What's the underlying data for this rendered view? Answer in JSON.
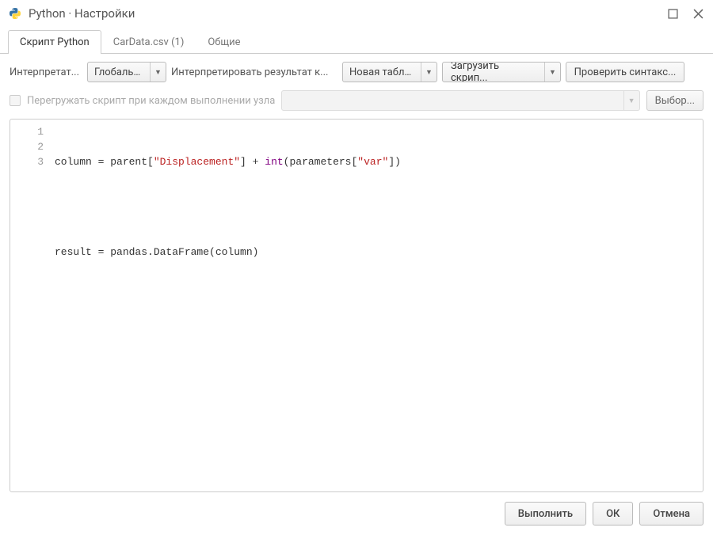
{
  "window": {
    "title": "Python · Настройки"
  },
  "tabs": [
    {
      "label": "Скрипт Python",
      "active": true
    },
    {
      "label": "CarData.csv (1)",
      "active": false
    },
    {
      "label": "Общие",
      "active": false
    }
  ],
  "toolbar": {
    "interpreter_label": "Интерпретат...",
    "interpreter_value": "Глобальн...",
    "interpret_as_label": "Интерпретировать результат к...",
    "interpret_as_value": "Новая табли...",
    "load_script": "Загрузить скрип...",
    "check_syntax": "Проверить синтакс..."
  },
  "reload": {
    "label": "Перегружать скрипт при каждом выполнении узла",
    "select": "Выбор..."
  },
  "code": {
    "lines": [
      "1",
      "2",
      "3"
    ],
    "l1_a": "column = parent[",
    "l1_b": "\"Displacement\"",
    "l1_c": "] + ",
    "l1_d": "int",
    "l1_e": "(parameters[",
    "l1_f": "\"var\"",
    "l1_g": "])",
    "l3": "result = pandas.DataFrame(column)"
  },
  "footer": {
    "execute": "Выполнить",
    "ok": "ОК",
    "cancel": "Отмена"
  }
}
